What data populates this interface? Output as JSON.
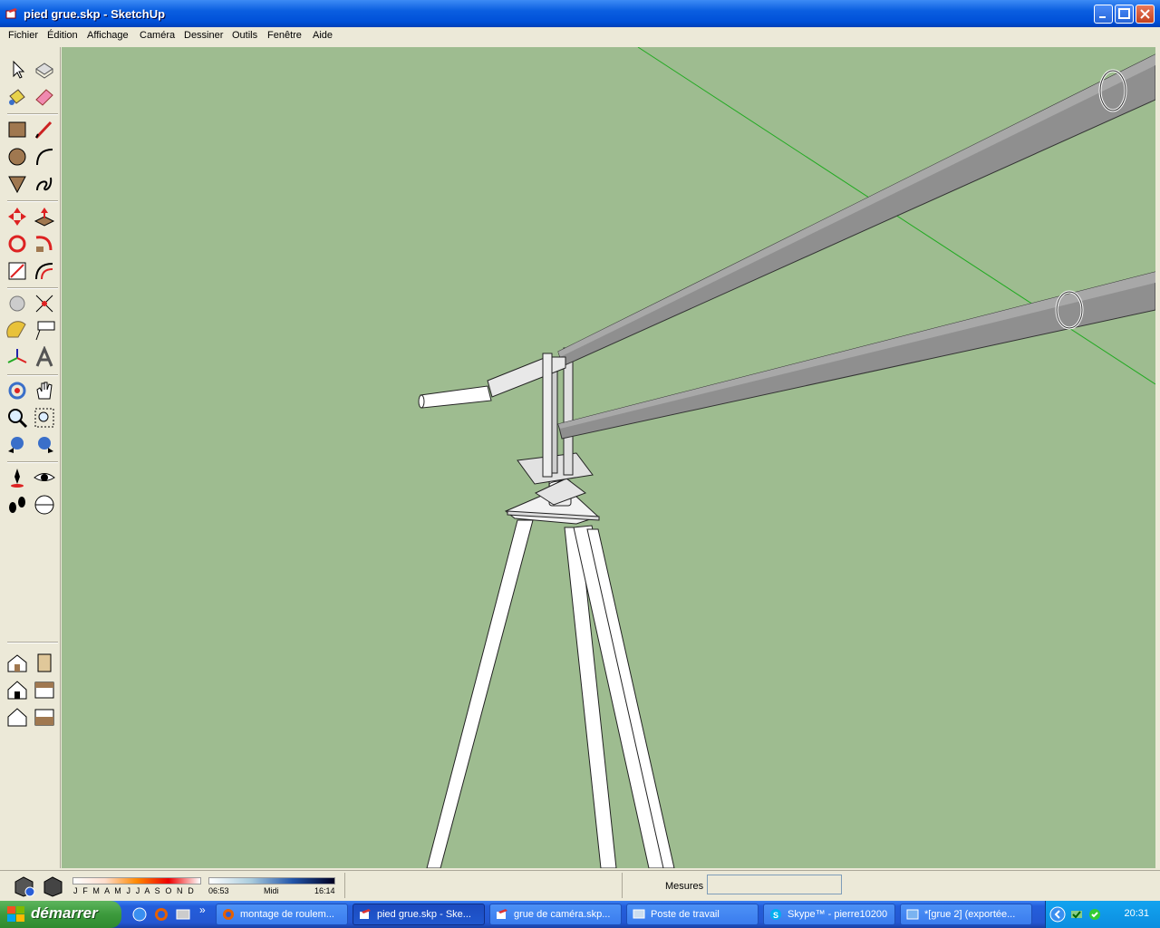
{
  "window": {
    "title": "pied grue.skp - SketchUp"
  },
  "menu": [
    "Fichier",
    "Édition",
    "Affichage",
    "Caméra",
    "Dessiner",
    "Outils",
    "Fenêtre",
    "Aide"
  ],
  "toolbar_icons": [
    "select-icon",
    "component-icon",
    "paint-bucket-icon",
    "eraser-icon",
    "rectangle-icon",
    "line-icon",
    "circle-icon",
    "arc-icon",
    "polygon-icon",
    "freehand-icon",
    "move-icon",
    "push-pull-icon",
    "rotate-icon",
    "follow-me-icon",
    "scale-icon",
    "offset-icon",
    "tape-measure-icon",
    "dimension-icon",
    "protractor-icon",
    "text-icon",
    "axes-icon",
    "3d-text-icon",
    "orbit-icon",
    "pan-icon",
    "zoom-icon",
    "zoom-window-icon",
    "previous-view-icon",
    "next-view-icon",
    "position-camera-icon",
    "look-around-icon",
    "walk-icon",
    "section-plane-icon",
    "iso-view-icon",
    "right-view-icon",
    "front-view-icon",
    "back-view-icon",
    "top-view-icon",
    "bottom-view-icon"
  ],
  "status": {
    "months": "J F M A M J J A S O N D",
    "time_start": "06:53",
    "time_mid": "Midi",
    "time_end": "16:14",
    "measures_label": "Mesures",
    "measures_value": ""
  },
  "taskbar": {
    "start_label": "démarrer",
    "buttons": [
      {
        "label": "montage de roulem...",
        "icon": "firefox-icon",
        "active": false
      },
      {
        "label": "pied grue.skp - Ske...",
        "icon": "sketchup-icon",
        "active": true
      },
      {
        "label": "grue de caméra.skp...",
        "icon": "sketchup-icon",
        "active": false
      },
      {
        "label": "Poste de travail",
        "icon": "computer-icon",
        "active": false
      },
      {
        "label": "Skype™ - pierre10200",
        "icon": "skype-icon",
        "active": false
      },
      {
        "label": "*[grue 2] (exportée...",
        "icon": "image-icon",
        "active": false
      }
    ],
    "quicklaunch_more": "»",
    "clock": "20:31"
  },
  "colors": {
    "viewport_bg": "#9ebc90",
    "boom": "#8c8c8c",
    "structure": "#ffffff",
    "green_axis": "#22aa22"
  }
}
